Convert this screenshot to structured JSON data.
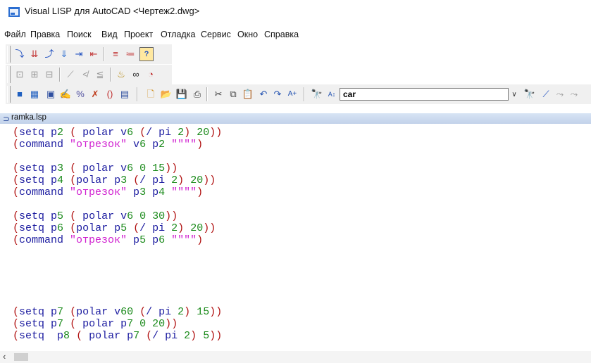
{
  "window": {
    "title": "Visual LISP для AutoCAD <Чертеж2.dwg>"
  },
  "menu": [
    "Файл",
    "Правка",
    "Поиск",
    "Вид",
    "Проект",
    "Отладка",
    "Сервис",
    "Окно",
    "Справка"
  ],
  "toolbar3": {
    "search_value": "car"
  },
  "tab": {
    "label": "ramka.lsp"
  },
  "code": [
    {
      "t": "(setq p2 ( polar v6 (/ pi 2) 20))"
    },
    {
      "t": "(command \"отрезок\" v6 p2 \"\"\"\")"
    },
    {
      "t": ""
    },
    {
      "t": "(setq p3 ( polar v6 0 15))"
    },
    {
      "t": "(setq p4 (polar p3 (/ pi 2) 20))"
    },
    {
      "t": "(command \"отрезок\" p3 p4 \"\"\"\")"
    },
    {
      "t": ""
    },
    {
      "t": "(setq p5 ( polar v6 0 30))"
    },
    {
      "t": "(setq p6 (polar p5 (/ pi 2) 20))"
    },
    {
      "t": "(command \"отрезок\" p5 p6 \"\"\"\")"
    },
    {
      "t": ""
    },
    {
      "t": ""
    },
    {
      "t": ""
    },
    {
      "t": ""
    },
    {
      "t": ""
    },
    {
      "t": "(setq p7 (polar v60 (/ pi 2) 15))"
    },
    {
      "t": "(setq p7 ( polar p7 0 20))"
    },
    {
      "t": "(setq  p8 ( polar p7 (/ pi 2) 5))"
    }
  ],
  "colors": {
    "string": "#d020d0",
    "number": "#1a8a1a",
    "paren": "#b01010",
    "keyword": "#1c1ca0"
  }
}
